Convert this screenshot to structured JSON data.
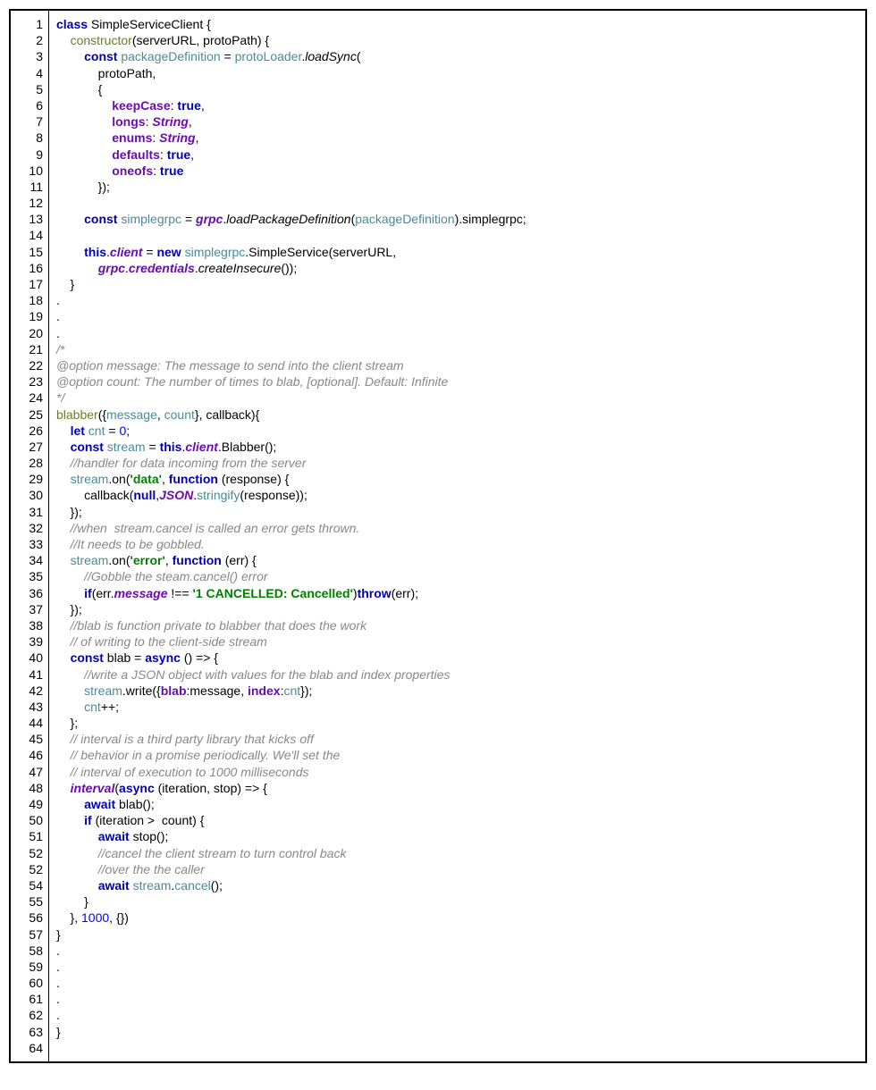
{
  "line_numbers": [
    "1",
    "2",
    "3",
    "4",
    "5",
    "6",
    "7",
    "8",
    "9",
    "10",
    "11",
    "12",
    "13",
    "14",
    "15",
    "16",
    "17",
    "18",
    "19",
    "20",
    "21",
    "22",
    "23",
    "24",
    "25",
    "26",
    "27",
    "28",
    "29",
    "30",
    "31",
    "32",
    "33",
    "34",
    "35",
    "36",
    "37",
    "38",
    "39",
    "40",
    "41",
    "42",
    "43",
    "44",
    "45",
    "46",
    "47",
    "48",
    "49",
    "50",
    "51",
    "52",
    "52",
    "54",
    "55",
    "56",
    "57",
    "58",
    "59",
    "60",
    "61",
    "62",
    "63",
    "64"
  ],
  "code_lines": [
    {
      "tokens": [
        [
          "kw",
          "class"
        ],
        [
          "id",
          " SimpleServiceClient {"
        ]
      ]
    },
    {
      "tokens": [
        [
          "id",
          "    "
        ],
        [
          "fn",
          "constructor"
        ],
        [
          "id",
          "(serverURL, protoPath) {"
        ]
      ]
    },
    {
      "tokens": [
        [
          "id",
          "        "
        ],
        [
          "kw",
          "const"
        ],
        [
          "id",
          " "
        ],
        [
          "var",
          "packageDefinition"
        ],
        [
          "id",
          " = "
        ],
        [
          "var",
          "protoLoader"
        ],
        [
          "id",
          "."
        ],
        [
          "mthd",
          "loadSync"
        ],
        [
          "id",
          "("
        ]
      ]
    },
    {
      "tokens": [
        [
          "id",
          "            protoPath,"
        ]
      ]
    },
    {
      "tokens": [
        [
          "id",
          "            {"
        ]
      ]
    },
    {
      "tokens": [
        [
          "id",
          "                "
        ],
        [
          "propn",
          "keepCase"
        ],
        [
          "id",
          ": "
        ],
        [
          "kw",
          "true"
        ],
        [
          "id",
          ","
        ]
      ]
    },
    {
      "tokens": [
        [
          "id",
          "                "
        ],
        [
          "propn",
          "longs"
        ],
        [
          "id",
          ": "
        ],
        [
          "builtin",
          "String"
        ],
        [
          "id",
          ","
        ]
      ]
    },
    {
      "tokens": [
        [
          "id",
          "                "
        ],
        [
          "propn",
          "enums"
        ],
        [
          "id",
          ": "
        ],
        [
          "builtin",
          "String"
        ],
        [
          "id",
          ","
        ]
      ]
    },
    {
      "tokens": [
        [
          "id",
          "                "
        ],
        [
          "propn",
          "defaults"
        ],
        [
          "id",
          ": "
        ],
        [
          "kw",
          "true"
        ],
        [
          "id",
          ","
        ]
      ]
    },
    {
      "tokens": [
        [
          "id",
          "                "
        ],
        [
          "propn",
          "oneofs"
        ],
        [
          "id",
          ": "
        ],
        [
          "kw",
          "true"
        ]
      ]
    },
    {
      "tokens": [
        [
          "id",
          "            });"
        ]
      ]
    },
    {
      "tokens": [
        [
          "id",
          ""
        ]
      ]
    },
    {
      "tokens": [
        [
          "id",
          "        "
        ],
        [
          "kw",
          "const"
        ],
        [
          "id",
          " "
        ],
        [
          "var",
          "simplegrpc"
        ],
        [
          "id",
          " = "
        ],
        [
          "prop",
          "grpc"
        ],
        [
          "id",
          "."
        ],
        [
          "mthd",
          "loadPackageDefinition"
        ],
        [
          "id",
          "("
        ],
        [
          "var",
          "packageDefinition"
        ],
        [
          "id",
          ").simplegrpc;"
        ]
      ]
    },
    {
      "tokens": [
        [
          "id",
          ""
        ]
      ]
    },
    {
      "tokens": [
        [
          "id",
          "        "
        ],
        [
          "kw",
          "this"
        ],
        [
          "id",
          "."
        ],
        [
          "mem",
          "client"
        ],
        [
          "id",
          " = "
        ],
        [
          "kw",
          "new"
        ],
        [
          "id",
          " "
        ],
        [
          "var",
          "simplegrpc"
        ],
        [
          "id",
          ".SimpleService(serverURL,"
        ]
      ]
    },
    {
      "tokens": [
        [
          "id",
          "            "
        ],
        [
          "prop",
          "grpc"
        ],
        [
          "id",
          "."
        ],
        [
          "prop",
          "credentials"
        ],
        [
          "id",
          "."
        ],
        [
          "mthd",
          "createInsecure"
        ],
        [
          "id",
          "());"
        ]
      ]
    },
    {
      "tokens": [
        [
          "id",
          "    }"
        ]
      ]
    },
    {
      "tokens": [
        [
          "id",
          "."
        ]
      ]
    },
    {
      "tokens": [
        [
          "id",
          "."
        ]
      ]
    },
    {
      "tokens": [
        [
          "id",
          "."
        ]
      ]
    },
    {
      "tokens": [
        [
          "cmt",
          "/*"
        ]
      ]
    },
    {
      "tokens": [
        [
          "cmt",
          "@option message: The message to send into the client stream"
        ]
      ]
    },
    {
      "tokens": [
        [
          "cmt",
          "@option count: The number of times to blab, [optional]. Default: Infinite"
        ]
      ]
    },
    {
      "tokens": [
        [
          "cmt",
          "*/"
        ]
      ]
    },
    {
      "tokens": [
        [
          "fn",
          "blabber"
        ],
        [
          "id",
          "({"
        ],
        [
          "var",
          "message"
        ],
        [
          "id",
          ", "
        ],
        [
          "var",
          "count"
        ],
        [
          "id",
          "}, callback){"
        ]
      ]
    },
    {
      "tokens": [
        [
          "id",
          "    "
        ],
        [
          "kw",
          "let"
        ],
        [
          "id",
          " "
        ],
        [
          "var",
          "cnt"
        ],
        [
          "id",
          " = "
        ],
        [
          "num",
          "0"
        ],
        [
          "id",
          ";"
        ]
      ]
    },
    {
      "tokens": [
        [
          "id",
          "    "
        ],
        [
          "kw",
          "const"
        ],
        [
          "id",
          " "
        ],
        [
          "var",
          "stream"
        ],
        [
          "id",
          " = "
        ],
        [
          "kw",
          "this"
        ],
        [
          "id",
          "."
        ],
        [
          "mem",
          "client"
        ],
        [
          "id",
          ".Blabber();"
        ]
      ]
    },
    {
      "tokens": [
        [
          "id",
          "    "
        ],
        [
          "cmt",
          "//handler for data incoming from the server"
        ]
      ]
    },
    {
      "tokens": [
        [
          "id",
          "    "
        ],
        [
          "var",
          "stream"
        ],
        [
          "id",
          ".on("
        ],
        [
          "str",
          "'data'"
        ],
        [
          "id",
          ", "
        ],
        [
          "kw",
          "function"
        ],
        [
          "id",
          " (response) {"
        ]
      ]
    },
    {
      "tokens": [
        [
          "id",
          "        callback("
        ],
        [
          "kw",
          "null"
        ],
        [
          "id",
          ","
        ],
        [
          "builtin",
          "JSON"
        ],
        [
          "id",
          "."
        ],
        [
          "var",
          "stringify"
        ],
        [
          "id",
          "(response));"
        ]
      ]
    },
    {
      "tokens": [
        [
          "id",
          "    });"
        ]
      ]
    },
    {
      "tokens": [
        [
          "id",
          "    "
        ],
        [
          "cmt",
          "//when  stream.cancel is called an error gets thrown."
        ]
      ]
    },
    {
      "tokens": [
        [
          "id",
          "    "
        ],
        [
          "cmt",
          "//It needs to be gobbled."
        ]
      ]
    },
    {
      "tokens": [
        [
          "id",
          "    "
        ],
        [
          "var",
          "stream"
        ],
        [
          "id",
          ".on("
        ],
        [
          "str",
          "'error'"
        ],
        [
          "id",
          ", "
        ],
        [
          "kw",
          "function"
        ],
        [
          "id",
          " (err) {"
        ]
      ]
    },
    {
      "tokens": [
        [
          "id",
          "        "
        ],
        [
          "cmt",
          "//Gobble the steam.cancel() error"
        ]
      ]
    },
    {
      "tokens": [
        [
          "id",
          "        "
        ],
        [
          "kw",
          "if"
        ],
        [
          "id",
          "(err."
        ],
        [
          "mem",
          "message"
        ],
        [
          "id",
          " !== "
        ],
        [
          "str",
          "'1 CANCELLED: Cancelled'"
        ],
        [
          "id",
          ")"
        ],
        [
          "kw",
          "throw"
        ],
        [
          "id",
          "(err);"
        ]
      ]
    },
    {
      "tokens": [
        [
          "id",
          "    });"
        ]
      ]
    },
    {
      "tokens": [
        [
          "id",
          "    "
        ],
        [
          "cmt",
          "//blab is function private to blabber that does the work"
        ]
      ]
    },
    {
      "tokens": [
        [
          "id",
          "    "
        ],
        [
          "cmt",
          "// of writing to the client-side stream"
        ]
      ]
    },
    {
      "tokens": [
        [
          "id",
          "    "
        ],
        [
          "kw",
          "const"
        ],
        [
          "id",
          " blab = "
        ],
        [
          "kw",
          "async"
        ],
        [
          "id",
          " () => {"
        ]
      ]
    },
    {
      "tokens": [
        [
          "id",
          "        "
        ],
        [
          "cmt",
          "//write a JSON object with values for the blab and index properties"
        ]
      ]
    },
    {
      "tokens": [
        [
          "id",
          "        "
        ],
        [
          "var",
          "stream"
        ],
        [
          "id",
          ".write({"
        ],
        [
          "propn",
          "blab"
        ],
        [
          "id",
          ":message, "
        ],
        [
          "propn",
          "index"
        ],
        [
          "id",
          ":"
        ],
        [
          "var",
          "cnt"
        ],
        [
          "id",
          "});"
        ]
      ]
    },
    {
      "tokens": [
        [
          "id",
          "        "
        ],
        [
          "var",
          "cnt"
        ],
        [
          "id",
          "++;"
        ]
      ]
    },
    {
      "tokens": [
        [
          "id",
          "    };"
        ]
      ]
    },
    {
      "tokens": [
        [
          "id",
          "    "
        ],
        [
          "cmt",
          "// interval is a third party library that kicks off"
        ]
      ]
    },
    {
      "tokens": [
        [
          "id",
          "    "
        ],
        [
          "cmt",
          "// behavior in a promise periodically. We'll set the"
        ]
      ]
    },
    {
      "tokens": [
        [
          "id",
          "    "
        ],
        [
          "cmt",
          "// interval of execution to 1000 milliseconds"
        ]
      ]
    },
    {
      "tokens": [
        [
          "id",
          "    "
        ],
        [
          "prop",
          "interval"
        ],
        [
          "id",
          "("
        ],
        [
          "kw",
          "async"
        ],
        [
          "id",
          " (iteration, stop) => {"
        ]
      ]
    },
    {
      "tokens": [
        [
          "id",
          "        "
        ],
        [
          "kw",
          "await"
        ],
        [
          "id",
          " blab();"
        ]
      ]
    },
    {
      "tokens": [
        [
          "id",
          "        "
        ],
        [
          "kw",
          "if"
        ],
        [
          "id",
          " (iteration >  count) {"
        ]
      ]
    },
    {
      "tokens": [
        [
          "id",
          "            "
        ],
        [
          "kw",
          "await"
        ],
        [
          "id",
          " stop();"
        ]
      ]
    },
    {
      "tokens": [
        [
          "id",
          "            "
        ],
        [
          "cmt",
          "//cancel the client stream to turn control back"
        ]
      ]
    },
    {
      "tokens": [
        [
          "id",
          "            "
        ],
        [
          "cmt",
          "//over the the caller"
        ]
      ]
    },
    {
      "tokens": [
        [
          "id",
          "            "
        ],
        [
          "kw",
          "await"
        ],
        [
          "id",
          " "
        ],
        [
          "var",
          "stream"
        ],
        [
          "id",
          "."
        ],
        [
          "var",
          "cancel"
        ],
        [
          "id",
          "();"
        ]
      ]
    },
    {
      "tokens": [
        [
          "id",
          "        }"
        ]
      ]
    },
    {
      "tokens": [
        [
          "id",
          "    }, "
        ],
        [
          "num",
          "1000"
        ],
        [
          "id",
          ", {})"
        ]
      ]
    },
    {
      "tokens": [
        [
          "id",
          "}"
        ]
      ]
    },
    {
      "tokens": [
        [
          "id",
          "."
        ]
      ]
    },
    {
      "tokens": [
        [
          "id",
          "."
        ]
      ]
    },
    {
      "tokens": [
        [
          "id",
          "."
        ]
      ]
    },
    {
      "tokens": [
        [
          "id",
          "."
        ]
      ]
    },
    {
      "tokens": [
        [
          "id",
          "."
        ]
      ]
    },
    {
      "tokens": [
        [
          "id",
          "}"
        ]
      ]
    },
    {
      "tokens": [
        [
          "id",
          ""
        ]
      ]
    }
  ]
}
